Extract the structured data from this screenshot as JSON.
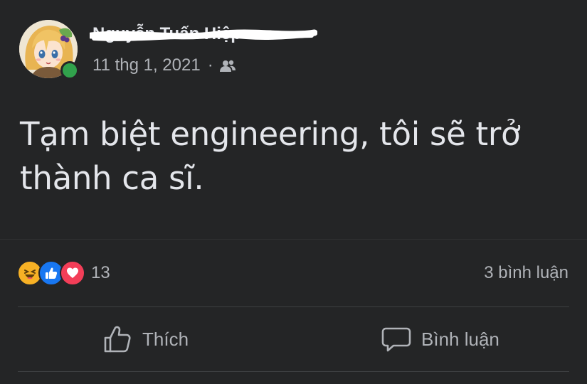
{
  "post": {
    "author": {
      "name": "Nguyễn Tuấn Hiệp",
      "online": true
    },
    "meta": {
      "date": "11 thg 1, 2021",
      "separator": "·",
      "audience_icon": "friends-icon"
    },
    "text": "Tạm biệt engineering, tôi sẽ trở thành ca sĩ.",
    "reactions": {
      "types": [
        "haha",
        "like",
        "love"
      ],
      "count": "13"
    },
    "comments_label": "3 bình luận",
    "actions": {
      "like_label": "Thích",
      "comment_label": "Bình luận"
    }
  },
  "colors": {
    "background": "#242526",
    "primary_text": "#e4e6eb",
    "secondary_text": "#b0b3b8",
    "online": "#31a24c",
    "like_blue": "#1877f2",
    "love_red": "#f33e58",
    "haha_yellow": "#f7b125"
  }
}
